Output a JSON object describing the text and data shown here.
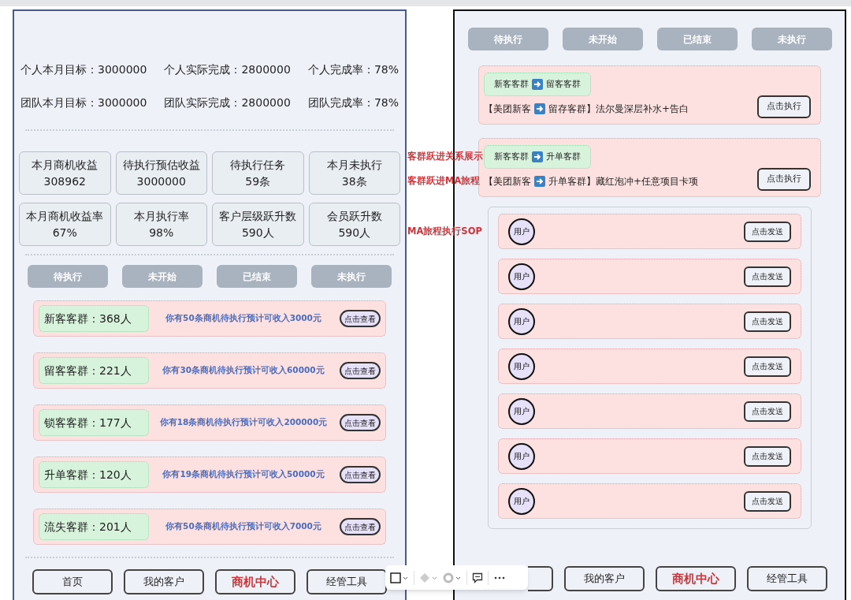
{
  "left_screen": {
    "stats": [
      [
        {
          "label": "个人本月目标：",
          "value": "3000000"
        },
        {
          "label": "个人实际完成：",
          "value": "2800000"
        },
        {
          "label": "个人完成率：",
          "value": "78%"
        }
      ],
      [
        {
          "label": "团队本月目标：",
          "value": "3000000"
        },
        {
          "label": "团队实际完成：",
          "value": "2800000"
        },
        {
          "label": "团队完成率：",
          "value": "78%"
        }
      ]
    ],
    "metrics": [
      {
        "label": "本月商机收益",
        "value": "308962"
      },
      {
        "label": "待执行预估收益",
        "value": "3000000"
      },
      {
        "label": "待执行任务",
        "value": "59条"
      },
      {
        "label": "本月未执行",
        "value": "38条"
      },
      {
        "label": "本月商机收益率",
        "value": "67%"
      },
      {
        "label": "本月执行率",
        "value": "98%"
      },
      {
        "label": "客户层级跃升数",
        "value": "590人"
      },
      {
        "label": "会员跃升数",
        "value": "590人"
      }
    ],
    "tabs": [
      "待执行",
      "未开始",
      "已结束",
      "未执行"
    ],
    "groups": [
      {
        "name": "新客客群：368人",
        "info": "你有50条商机待执行预计可收入3000元",
        "button": "点击查看"
      },
      {
        "name": "留客客群：221人",
        "info": "你有30条商机待执行预计可收入60000元",
        "button": "点击查看"
      },
      {
        "name": "锁客客群：177人",
        "info": "你有18条商机待执行预计可收入200000元",
        "button": "点击查看"
      },
      {
        "name": "升单客群：120人",
        "info": "你有19条商机待执行预计可收入50000元",
        "button": "点击查看"
      },
      {
        "name": "流失客群：201人",
        "info": "你有50条商机待执行预计可收入7000元",
        "button": "点击查看"
      }
    ],
    "nav": [
      {
        "label": "首页",
        "active": false
      },
      {
        "label": "我的客户",
        "active": false
      },
      {
        "label": "商机中心",
        "active": true
      },
      {
        "label": "经管工具",
        "active": false
      }
    ]
  },
  "annotations": [
    "客群跃进关系展示",
    "客群跃进MA旅程",
    "MA旅程执行SOP"
  ],
  "right_screen": {
    "tabs": [
      "待执行",
      "未开始",
      "已结束",
      "未执行"
    ],
    "journeys": [
      {
        "from": "新客客群",
        "to": "留客客群",
        "route_from": "【美团新客",
        "route_to": "留存客群】法尔曼深层补水+告白",
        "button": "点击执行"
      },
      {
        "from": "新客客群",
        "to": "升单客群",
        "route_from": "【美团新客",
        "route_to": "升单客群】藏红泡冲+任意项目卡项",
        "button": "点击执行"
      }
    ],
    "sop_rows": [
      {
        "avatar": "用户",
        "button": "点击发送"
      },
      {
        "avatar": "用户",
        "button": "点击发送"
      },
      {
        "avatar": "用户",
        "button": "点击发送"
      },
      {
        "avatar": "用户",
        "button": "点击发送"
      },
      {
        "avatar": "用户",
        "button": "点击发送"
      },
      {
        "avatar": "用户",
        "button": "点击发送"
      },
      {
        "avatar": "用户",
        "button": "点击发送"
      }
    ],
    "nav": [
      {
        "label": "我的客户",
        "active": false
      },
      {
        "label": "商机中心",
        "active": true
      },
      {
        "label": "经管工具",
        "active": false
      }
    ]
  }
}
